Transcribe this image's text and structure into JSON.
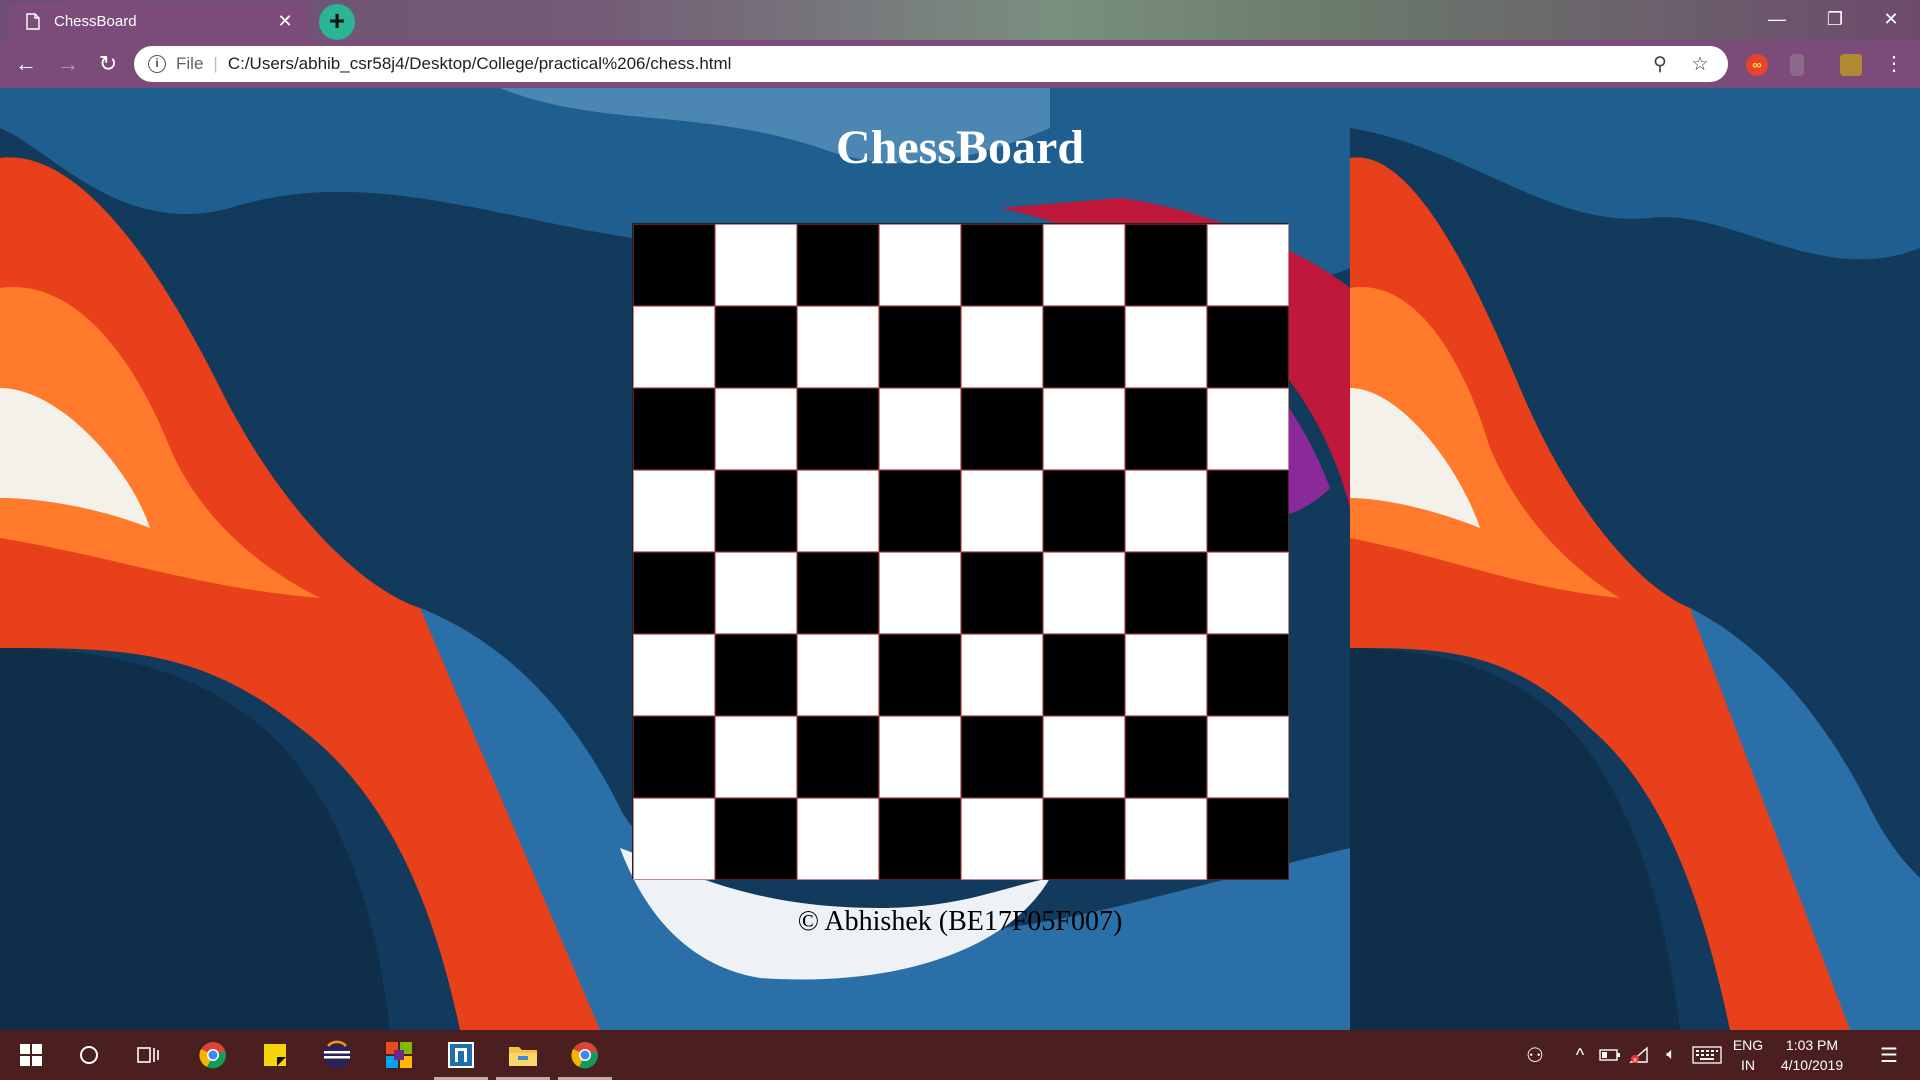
{
  "browser": {
    "tab": {
      "title": "ChessBoard",
      "close_glyph": "✕",
      "icon": "page-icon"
    },
    "new_tab_glyph": "+",
    "window_controls": {
      "minimize": "—",
      "restore": "❐",
      "close": "✕"
    },
    "nav": {
      "back": "←",
      "forward": "→",
      "reload": "↻"
    },
    "omnibox": {
      "info_glyph": "i",
      "scheme_label": "File",
      "separator": "|",
      "url": "C:/Users/abhib_csr58j4/Desktop/College/practical%206/chess.html",
      "zoom_glyph": "⚲",
      "bookmark_glyph": "☆"
    },
    "menu_glyph": "⋮"
  },
  "page": {
    "title": "ChessBoard",
    "copyright": "© Abhishek (BE17F05F007)",
    "board": {
      "rows": 8,
      "cols": 8,
      "top_left": "black",
      "colors": {
        "black": "#000000",
        "white": "#ffffff"
      }
    }
  },
  "taskbar": {
    "start_icon": "windows-logo-icon",
    "apps": [
      "search-circle-icon",
      "task-view-icon",
      "chrome-icon",
      "sticky-notes-icon",
      "eclipse-icon",
      "office-icon",
      "code-editor-icon",
      "file-explorer-icon",
      "chrome-active-icon"
    ],
    "tray": {
      "people_glyph": "⚇",
      "chevron_glyph": "^",
      "volume_glyph": "🔈︎",
      "lang_top": "ENG",
      "lang_bottom": "IN",
      "time": "1:03 PM",
      "date": "4/10/2019",
      "notifications_glyph": "☰"
    }
  },
  "colors": {
    "tab_active": "#7b4b79",
    "new_tab": "#2bb594",
    "taskbar": "#4b1f20"
  }
}
